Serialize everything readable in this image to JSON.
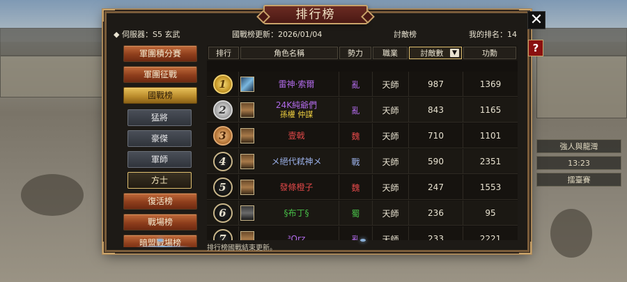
{
  "title": "排行榜",
  "info": {
    "server": "◆ 伺服器：S5 玄武",
    "update": "國戰榜更新：2026/01/04",
    "board": "討敵榜",
    "my_rank": "我的排名：14"
  },
  "sidebar": {
    "top": [
      {
        "label": "軍團積分賽",
        "active": false
      },
      {
        "label": "軍團征戰",
        "active": false
      },
      {
        "label": "國戰榜",
        "active": true
      }
    ],
    "sub": [
      {
        "label": "猛將",
        "active": false
      },
      {
        "label": "豪傑",
        "active": false
      },
      {
        "label": "軍師",
        "active": false
      },
      {
        "label": "方士",
        "active": true
      }
    ],
    "bottom": [
      {
        "label": "復活榜",
        "active": false
      },
      {
        "label": "戰場榜",
        "active": false
      },
      {
        "label": "暗盟戰場榜",
        "active": false
      }
    ]
  },
  "table": {
    "headers": [
      "排行",
      "角色名稱",
      "勢力",
      "職業",
      "討敵數",
      "功勳"
    ],
    "sorted_column": "討敵數",
    "sort_icon": "sort-descending-icon",
    "rows": [
      {
        "rank": "1",
        "medal": "gold",
        "avatar": "blue",
        "name": "雷神·索爾",
        "name2": "",
        "name_color": "#b06ae8",
        "faction": "亂",
        "faction_color": "#b06ae8",
        "job": "天師",
        "kills": "987",
        "merit": "1369"
      },
      {
        "rank": "2",
        "medal": "silver",
        "avatar": "brown",
        "name": "24K純爺們",
        "name2": "孫權 仲謀",
        "name_color": "#b06ae8",
        "name2_color": "#f0d040",
        "faction": "亂",
        "faction_color": "#b06ae8",
        "job": "天師",
        "kills": "843",
        "merit": "1165"
      },
      {
        "rank": "3",
        "medal": "bronze",
        "avatar": "brown",
        "name": "壹戟",
        "name2": "",
        "name_color": "#e04848",
        "faction": "魏",
        "faction_color": "#e04848",
        "job": "天師",
        "kills": "710",
        "merit": "1101"
      },
      {
        "rank": "4",
        "medal": "plain",
        "avatar": "brown",
        "name": "メ絕代弒神メ",
        "name2": "",
        "name_color": "#9ab0e8",
        "faction": "戰",
        "faction_color": "#9ab0e8",
        "job": "天師",
        "kills": "590",
        "merit": "2351"
      },
      {
        "rank": "5",
        "medal": "plain",
        "avatar": "brown",
        "name": "發條橙子",
        "name2": "",
        "name_color": "#e04848",
        "faction": "魏",
        "faction_color": "#e04848",
        "job": "天師",
        "kills": "247",
        "merit": "1553"
      },
      {
        "rank": "6",
        "medal": "plain",
        "avatar": "dark",
        "name": "§布丁§",
        "name2": "",
        "name_color": "#48c048",
        "faction": "蜀",
        "faction_color": "#48c048",
        "job": "天師",
        "kills": "236",
        "merit": "95"
      },
      {
        "rank": "7",
        "medal": "plain",
        "avatar": "brown",
        "name": "³Orz",
        "name2": "",
        "name_color": "#b06ae8",
        "faction": "亂",
        "faction_color": "#b06ae8",
        "job": "天師",
        "kills": "233",
        "merit": "2221"
      }
    ]
  },
  "footer": "排行榜國戰結束更新。",
  "close_label": "✕",
  "help_label": "?",
  "background_tags": [
    "強人與龍灣",
    "13:23",
    "擂臺賽"
  ]
}
